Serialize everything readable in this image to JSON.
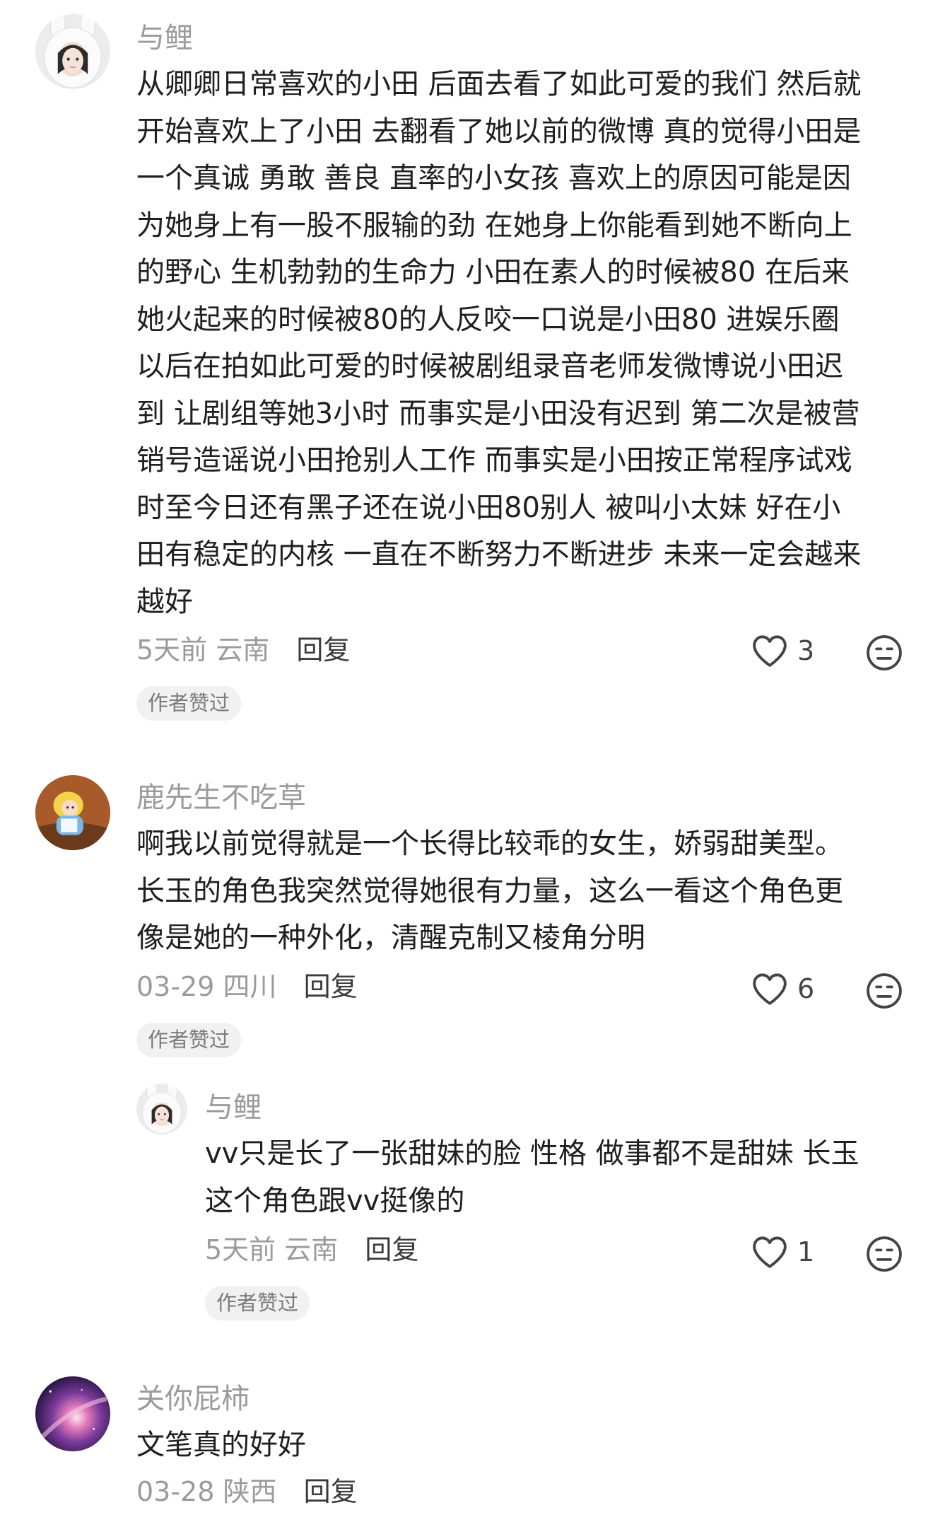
{
  "comments": [
    {
      "username": "与鲤",
      "lines": [
        "从卿卿日常喜欢的小田 后面去看了如此可爱的我们 然后就",
        "开始喜欢上了小田 去翻看了她以前的微博 真的觉得小田是",
        "一个真诚 勇敢 善良 直率的小女孩 喜欢上的原因可能是因",
        "为她身上有一股不服输的劲 在她身上你能看到她不断向上",
        "的野心 生机勃勃的生命力 小田在素人的时候被80 在后来",
        "她火起来的时候被80的人反咬一口说是小田80 进娱乐圈",
        "以后在拍如此可爱的时候被剧组录音老师发微博说小田迟",
        "到 让剧组等她3小时 而事实是小田没有迟到 第二次是被营",
        "销号造谣说小田抢别人工作 而事实是小田按正常程序试戏",
        "时至今日还有黑子还在说小田80别人 被叫小太妹  好在小",
        "田有稳定的内核 一直在不断努力不断进步 未来一定会越来",
        "越好"
      ],
      "time": "5天前",
      "location": "云南",
      "reply_label": "回复",
      "likes": "3",
      "badge": "作者赞过"
    },
    {
      "username": "鹿先生不吃草",
      "lines": [
        "啊我以前觉得就是一个长得比较乖的女生，娇弱甜美型。",
        "长玉的角色我突然觉得她很有力量，这么一看这个角色更",
        "像是她的一种外化，清醒克制又棱角分明"
      ],
      "time": "03-29",
      "location": "四川",
      "reply_label": "回复",
      "likes": "6",
      "badge": "作者赞过"
    },
    {
      "username": "与鲤",
      "lines": [
        "vv只是长了一张甜妹的脸 性格 做事都不是甜妹 长玉",
        "这个角色跟vv挺像的"
      ],
      "time": "5天前",
      "location": "云南",
      "reply_label": "回复",
      "likes": "1",
      "badge": "作者赞过"
    },
    {
      "username": "关你屁柿",
      "lines": [
        "文笔真的好好"
      ],
      "time": "03-28",
      "location": "陕西",
      "reply_label": "回复"
    }
  ]
}
